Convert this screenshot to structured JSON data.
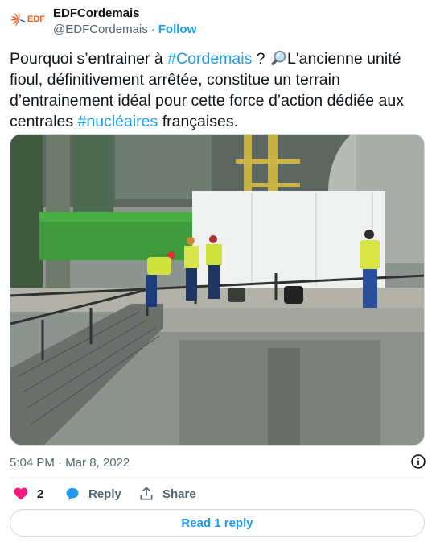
{
  "author": {
    "display_name": "EDFCordemais",
    "handle": "@EDFCordemais",
    "separator": "·",
    "follow_label": "Follow",
    "logo_text": "EDF",
    "brand_color": "#fe5716"
  },
  "tweet": {
    "text_1": "Pourquoi s’entrainer à ",
    "hashtag_1": "#Cordemais",
    "text_2": " ? ",
    "emoji": "magnifying-glass-icon",
    "text_3": "L'ancienne unité fioul, définitivement arrêtée, constitue un terrain d’entrainement idéal pour cette force d’action dédiée aux centrales ",
    "hashtag_2": "#nucléaires",
    "text_4": " françaises."
  },
  "timestamp": "5:04 PM · Mar 8, 2022",
  "actions": {
    "like_count": "2",
    "reply_label": "Reply",
    "share_label": "Share"
  },
  "read_replies_label": "Read 1 reply",
  "colors": {
    "accent": "#1d9bf0",
    "like": "#f91880",
    "muted": "#536471"
  }
}
